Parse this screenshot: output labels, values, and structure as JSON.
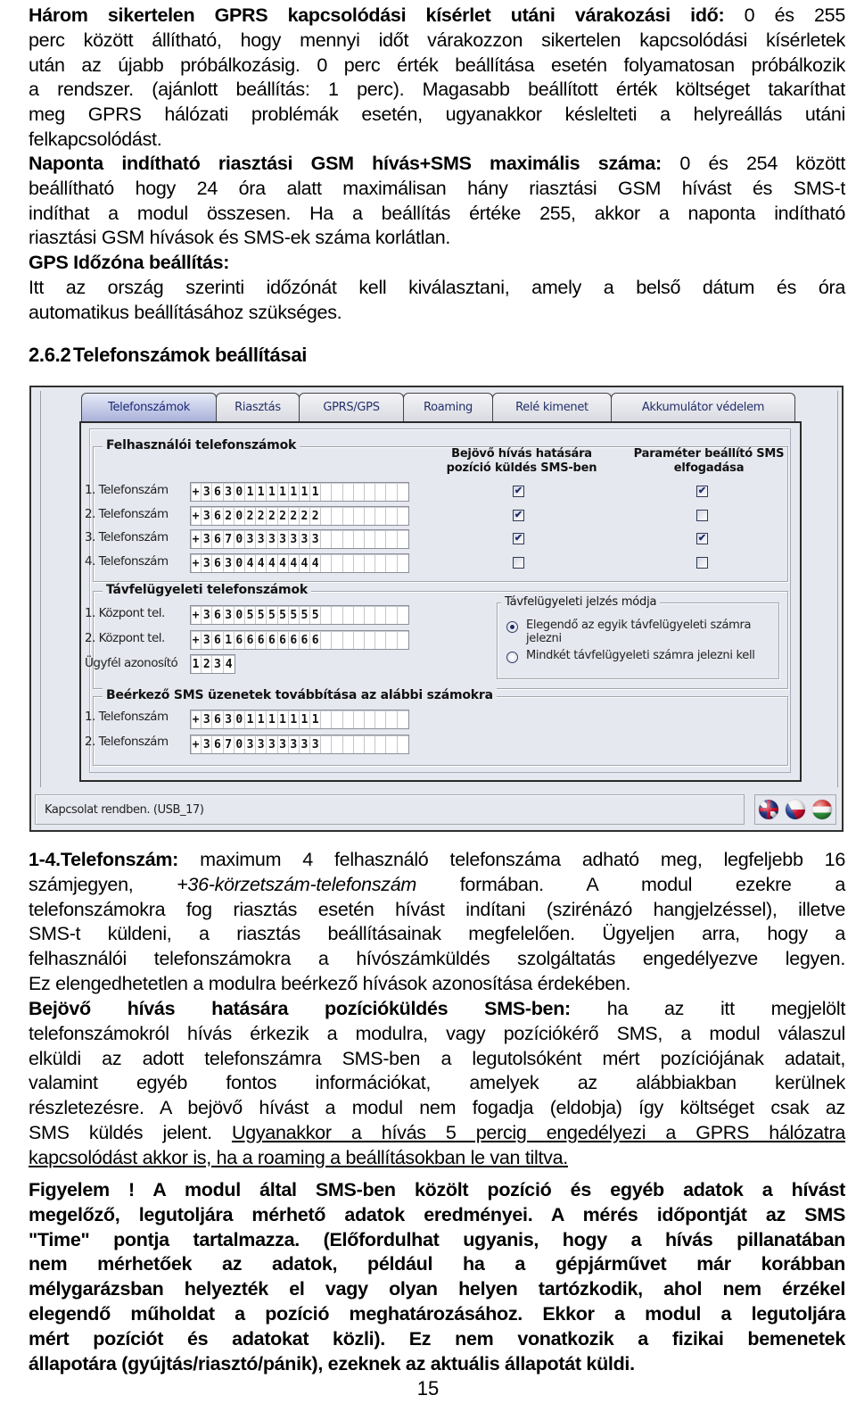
{
  "top_paragraphs": {
    "p1": {
      "bold": "Három sikertelen GPRS kapcsolódási kísérlet utáni várakozási idő:",
      "lines": [
        " 0 és 255",
        "perc között állítható, hogy mennyi időt várakozzon sikertelen kapcsolódási kísérletek",
        "után az újabb próbálkozásig. 0 perc érték beállítása esetén folyamatosan próbálkozik",
        "a rendszer. (ajánlott beállítás: 1 perc). Magasabb beállított érték költséget takaríthat",
        "meg GPRS hálózati problémák esetén, ugyanakkor késlelteti a helyreállás utáni",
        "felkapcsolódást."
      ]
    },
    "p2": {
      "bold": "Naponta indítható riasztási GSM hívás+SMS maximális száma:",
      "lines": [
        " 0 és 254 között",
        "beállítható hogy 24 óra alatt maximálisan hány riasztási GSM hívást és SMS-t",
        "indíthat a modul összesen. Ha a beállítás értéke 255, akkor a naponta indítható",
        "riasztási GSM hívások és SMS-ek száma korlátlan."
      ]
    },
    "p3": {
      "heading": "GPS Időzóna beállítás:",
      "lines": [
        "Itt az ország szerinti időzónát kell kiválasztani, amely a belső dátum és óra",
        "automatikus beállításához szükséges."
      ]
    }
  },
  "section": {
    "number": "2.6.2",
    "title": "Telefonszámok beállításai"
  },
  "app": {
    "tabs": [
      {
        "label": "Telefonszámok",
        "active": true
      },
      {
        "label": "Riasztás",
        "active": false
      },
      {
        "label": "GPRS/GPS",
        "active": false
      },
      {
        "label": "Roaming",
        "active": false
      },
      {
        "label": "Relé kimenet",
        "active": false
      },
      {
        "label": "Akkumulátor védelem",
        "active": false
      }
    ],
    "user_group": {
      "title": "Felhasználói telefonszámok",
      "col_position_sms": "Bejövő hívás hatására\npozíció küldés SMS-ben",
      "col_param_sms": "Paraméter beállító SMS\nelfogadása",
      "rows": [
        {
          "label": "1. Telefonszám",
          "value": "+36301111111",
          "position_sms": true,
          "param_sms": true
        },
        {
          "label": "2. Telefonszám",
          "value": "+36202222222",
          "position_sms": true,
          "param_sms": false
        },
        {
          "label": "3. Telefonszám",
          "value": "+36703333333",
          "position_sms": true,
          "param_sms": true
        },
        {
          "label": "4. Telefonszám",
          "value": "+36304444444",
          "position_sms": false,
          "param_sms": false
        }
      ]
    },
    "monitor_group": {
      "title": "Távfelügyeleti telefonszámok",
      "rows": [
        {
          "label": "1. Központ tel.",
          "value": "+36305555555"
        },
        {
          "label": "2. Központ tel.",
          "value": "+36166666666"
        }
      ],
      "client_id": {
        "label": "Ügyfél azonosító",
        "value": "1234"
      },
      "signal_mode": {
        "title": "Távfelügyeleti jelzés módja",
        "options": [
          {
            "label": "Elegendő az egyik távfelügyeleti számra jelezni",
            "selected": true
          },
          {
            "label": "Mindkét távfelügyeleti számra jelezni kell",
            "selected": false
          }
        ]
      }
    },
    "sms_forward_group": {
      "title": "Beérkező SMS üzenetek továbbítása az alábbi számokra",
      "rows": [
        {
          "label": "1. Telefonszám",
          "value": "+36301111111"
        },
        {
          "label": "2. Telefonszám",
          "value": "+36703333333"
        }
      ]
    },
    "status": "Kapcsolat rendben. (USB_17)",
    "languages": [
      {
        "name": "english-flag-icon",
        "label": "English"
      },
      {
        "name": "czech-flag-icon",
        "label": "Czech"
      },
      {
        "name": "hungarian-flag-icon",
        "label": "Hungarian"
      }
    ]
  },
  "bottom_paragraphs": {
    "p1": {
      "bold": "1-4.Telefonszám:",
      "lines": [
        " maximum 4 felhasználó telefonszáma adható meg, legfeljebb 16",
        "számjegyen,|+36-körzetszám-telefonszám| formában. A modul ezekre a",
        "telefonszámokra fog riasztás esetén hívást indítani (szirénázó hangjelzéssel), illetve",
        "SMS-t küldeni, a riasztás beállításainak megfelelően. Ügyeljen arra, hogy a",
        "felhasználói telefonszámokra a hívószámküldés szolgáltatás engedélyezve legyen.",
        "Ez elengedhetetlen a modulra beérkező hívások azonosítása érdekében."
      ]
    },
    "p2": {
      "bold": "Bejövő hívás hatására pozícióküldés SMS-ben:",
      "lines": [
        " ha az itt megjelölt",
        "telefonszámokról hívás érkezik a modulra, vagy pozíciókérő SMS, a modul válaszul",
        "elküldi az adott telefonszámra SMS-ben a legutolsóként mért pozíciójának adatait,",
        "valamint egyéb fontos információkat, amelyek az alábbiakban kerülnek",
        "részletezésre. A bejövő hívást a modul nem fogadja (eldobja) így költséget csak az",
        "SMS küldés jelent. "
      ],
      "underlined": [
        "Ugyanakkor a hívás 5 percig engedélyezi a GPRS hálózatra",
        "kapcsolódást akkor is, ha a roaming a beállításokban le van tiltva."
      ]
    },
    "warning": {
      "lines": [
        "Figyelem ! A modul által SMS-ben közölt pozíció és egyéb adatok a hívást",
        "megelőző, legutoljára mérhető adatok eredményei. A mérés időpontját az SMS",
        "\"Time\" pontja tartalmazza. (Előfordulhat ugyanis, hogy a hívás pillanatában",
        "nem mérhetőek az adatok, például ha a gépjárművet már korábban",
        "mélygarázsban helyezték el vagy olyan helyen tartózkodik, ahol nem érzékel",
        "elegendő műholdat a pozíció meghatározásához. Ekkor a modul a legutoljára",
        "mért pozíciót és adatokat közli). Ez nem vonatkozik a fizikai bemenetek",
        "állapotára (gyújtás/riasztó/pánik), ezeknek az aktuális állapotát küldi."
      ]
    }
  },
  "page_number": "15"
}
